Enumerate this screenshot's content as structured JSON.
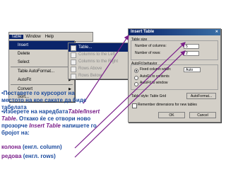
{
  "menubar": {
    "items": [
      "Table",
      "Window",
      "Help"
    ]
  },
  "menu": {
    "items": [
      {
        "label": "Insert",
        "has_arrow": true
      },
      {
        "label": "Delete",
        "has_arrow": true
      },
      {
        "label": "Select",
        "has_arrow": true
      },
      {
        "label": "Table AutoFormat...",
        "has_arrow": false
      },
      {
        "label": "AutoFit",
        "has_arrow": true
      },
      {
        "label": "Convert",
        "has_arrow": true
      },
      {
        "label": "Sort...",
        "has_arrow": false
      }
    ]
  },
  "submenu": {
    "items": [
      "Table...",
      "Columns to the Left",
      "Columns to the Right",
      "Rows Above",
      "Rows Below"
    ]
  },
  "dialog": {
    "title": "Insert Table",
    "table_size_label": "Table size",
    "columns_label": "Number of columns:",
    "columns_value": "5",
    "rows_label": "Number of rows:",
    "rows_value": "2",
    "autofit_label": "AutoFit behavior",
    "fixed_width_label": "Fixed column width:",
    "fixed_width_value": "Auto",
    "autofit_contents_label": "AutoFit to contents",
    "autofit_window_label": "AutoFit to window",
    "table_style_label": "Table style: Table Grid",
    "autoformat_button": "AutoFormat...",
    "remember_label": "Remember dimensions for new tables",
    "ok_button": "OK",
    "cancel_button": "Cancel"
  },
  "text": {
    "b1_part1": "•Поставете го курсорот на местото на кое сакате да биде табелата",
    "b2_part1": "•Изберете на наредбата",
    "b2_em1": "Table/Insert Table",
    "b2_part2": ". Откако ќе се отвори ново прозорче",
    "b2_em2": "Insert Table",
    "b2_part3": "напишете го бројот на:",
    "colona": "колона",
    "colona_en": "(енгл. column)",
    "redova": "редова",
    "redova_en": "(енгл. rows)"
  },
  "colors": {
    "blue": "#1a4a9e",
    "purple": "#7a1f8a",
    "menu_highlight": "#0a246a"
  }
}
